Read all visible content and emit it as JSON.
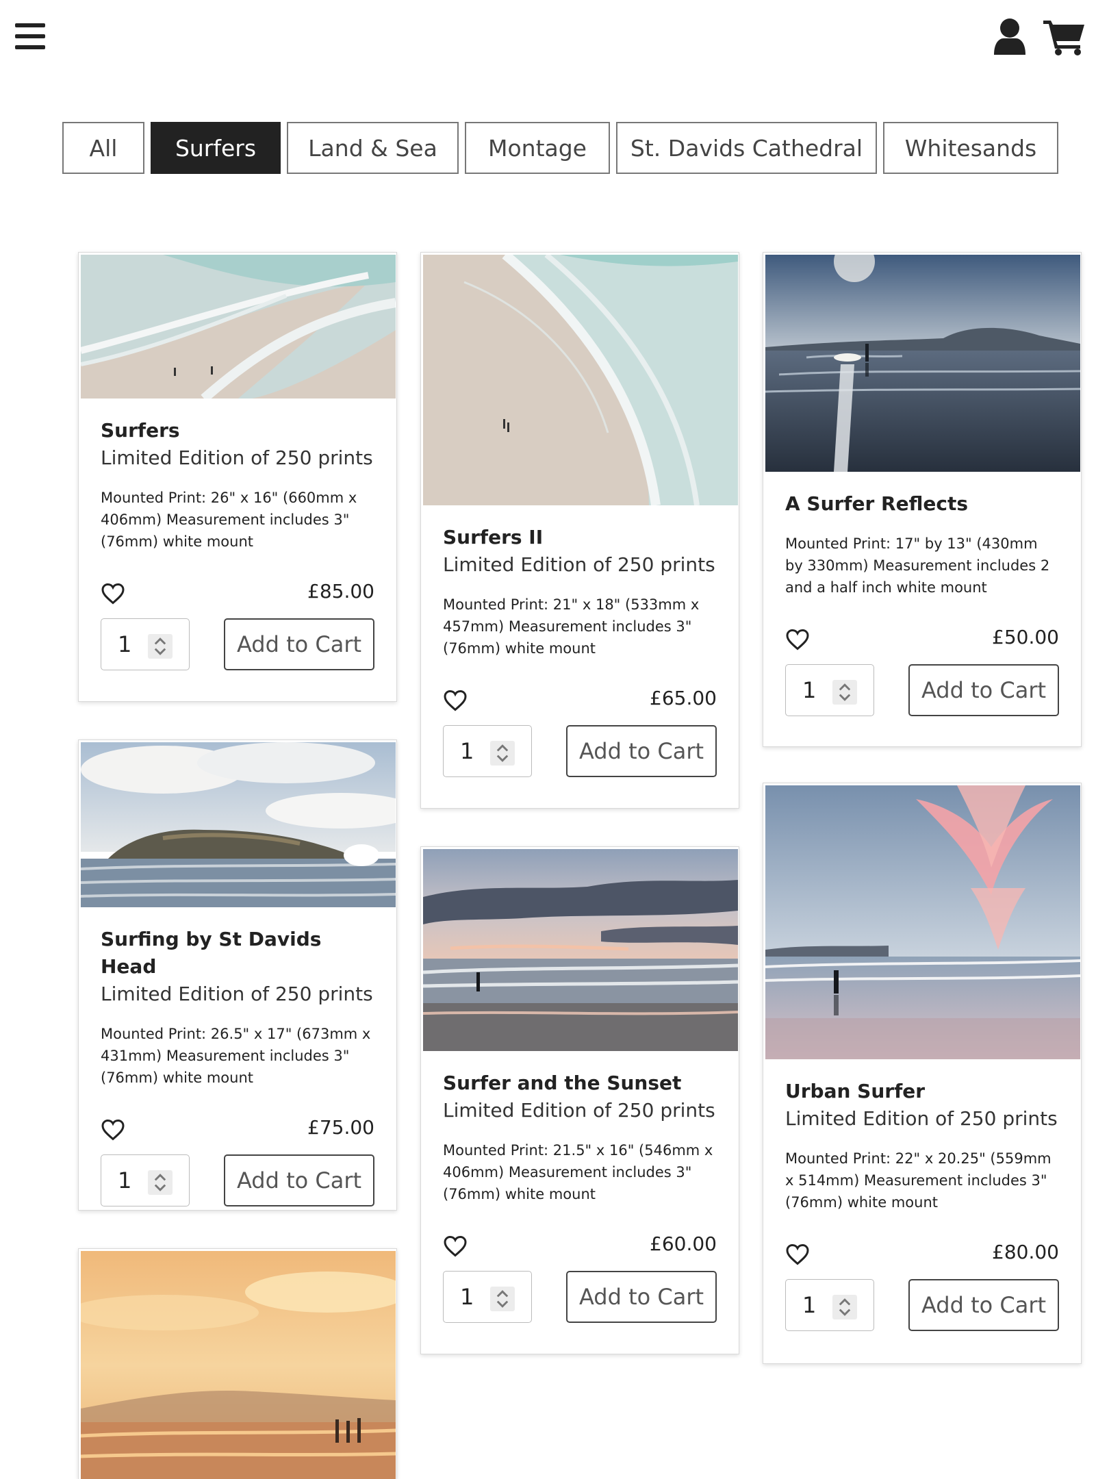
{
  "header": {
    "menu_icon": "hamburger-icon",
    "account_icon": "user-icon",
    "cart_icon": "shopping-cart-icon"
  },
  "filters": [
    {
      "label": "All",
      "active": false
    },
    {
      "label": "Surfers",
      "active": true
    },
    {
      "label": "Land & Sea",
      "active": false
    },
    {
      "label": "Montage",
      "active": false
    },
    {
      "label": "St. Davids Cathedral",
      "active": false
    },
    {
      "label": "Whitesands",
      "active": false
    }
  ],
  "products": [
    {
      "title": "Surfers",
      "edition": "Limited Edition of 250 prints",
      "description": "Mounted Print: 26\" x 16\" (660mm x 406mm) Measurement includes 3\" (76mm) white mount",
      "price": "£85.00",
      "quantity": "1",
      "button": "Add to Cart"
    },
    {
      "title": "Surfers II",
      "edition": "Limited Edition of 250 prints",
      "description": "Mounted Print: 21\" x 18\" (533mm x 457mm) Measurement includes 3\" (76mm) white mount",
      "price": "£65.00",
      "quantity": "1",
      "button": "Add to Cart"
    },
    {
      "title": "A Surfer Reflects",
      "edition": "",
      "description": "Mounted Print: 17\" by 13\" (430mm by 330mm) Measurement includes 2 and a half inch white mount",
      "price": "£50.00",
      "quantity": "1",
      "button": "Add to Cart"
    },
    {
      "title": "Surfing by St Davids Head",
      "edition": "Limited Edition of 250 prints",
      "description": "Mounted Print: 26.5\" x 17\" (673mm x 431mm) Measurement includes 3\" (76mm) white mount",
      "price": "£75.00",
      "quantity": "1",
      "button": "Add to Cart"
    },
    {
      "title": "Surfer and the Sunset",
      "edition": "Limited Edition of 250 prints",
      "description": "Mounted Print: 21.5\" x 16\" (546mm x 406mm) Measurement includes 3\" (76mm) white mount",
      "price": "£60.00",
      "quantity": "1",
      "button": "Add to Cart"
    },
    {
      "title": "Urban Surfer",
      "edition": "Limited Edition of 250 prints",
      "description": "Mounted Print: 22\" x 20.25\" (559mm x 514mm) Measurement includes 3\" (76mm) white mount",
      "price": "£80.00",
      "quantity": "1",
      "button": "Add to Cart"
    }
  ]
}
